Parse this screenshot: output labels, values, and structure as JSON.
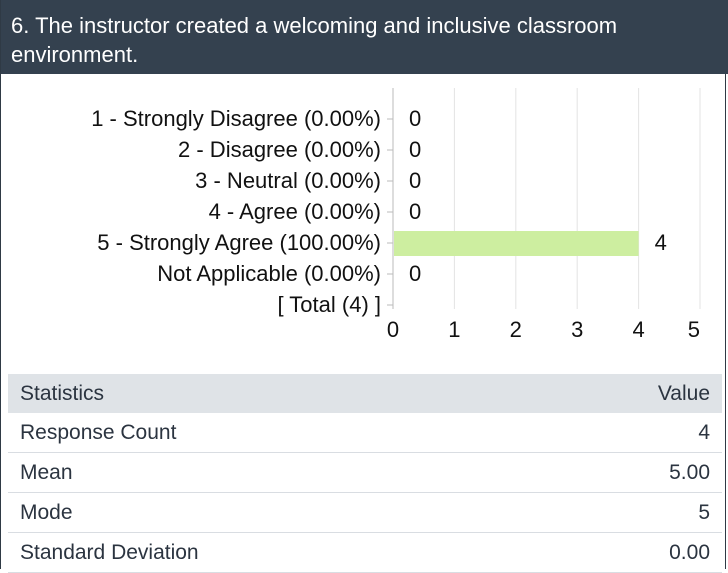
{
  "question": {
    "title": "6. The instructor created a welcoming and inclusive classroom environment."
  },
  "chart_data": {
    "type": "bar",
    "orientation": "horizontal",
    "categories": [
      "1 - Strongly Disagree (0.00%)",
      "2 - Disagree (0.00%)",
      "3 - Neutral (0.00%)",
      "4 - Agree (0.00%)",
      "5 - Strongly Agree (100.00%)",
      "Not Applicable (0.00%)",
      "[ Total (4) ]"
    ],
    "values": [
      0,
      0,
      0,
      0,
      4,
      0,
      null
    ],
    "value_labels": [
      "0",
      "0",
      "0",
      "0",
      "4",
      "0",
      ""
    ],
    "xlim": [
      0,
      5
    ],
    "xticks": [
      "0",
      "1",
      "2",
      "3",
      "4",
      "5"
    ],
    "bar_color": "#cdeea0",
    "grid": true
  },
  "statistics": {
    "header": {
      "label": "Statistics",
      "value": "Value"
    },
    "rows": [
      {
        "label": "Response Count",
        "value": "4"
      },
      {
        "label": "Mean",
        "value": "5.00"
      },
      {
        "label": "Mode",
        "value": "5"
      },
      {
        "label": "Standard Deviation",
        "value": "0.00"
      }
    ]
  }
}
